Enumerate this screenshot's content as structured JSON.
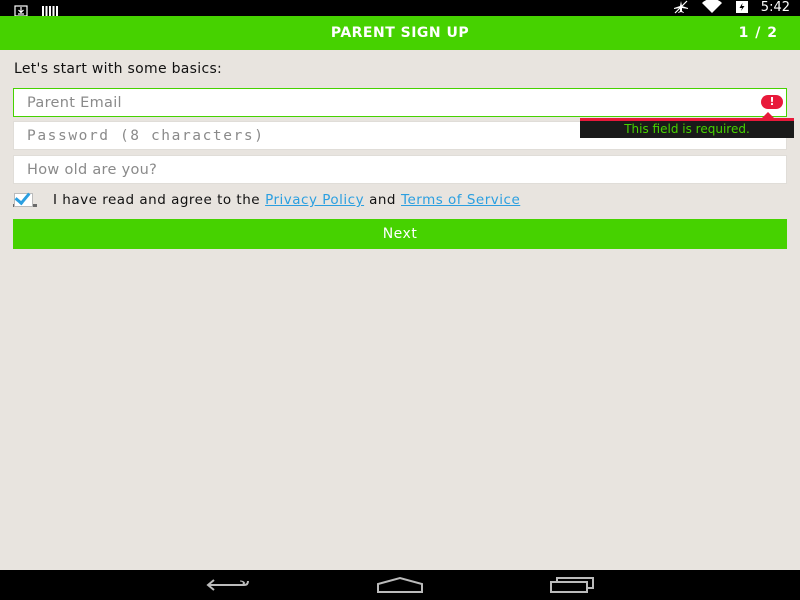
{
  "status_bar": {
    "left_icons": [
      "download-icon",
      "barcode-icon"
    ],
    "right_icons": [
      "airplane-mode-icon",
      "wifi-icon",
      "battery-icon"
    ],
    "time": "5:42"
  },
  "header": {
    "title": "PARENT SIGN UP",
    "step": "1 / 2"
  },
  "form": {
    "intro": "Let's start with some basics:",
    "email_placeholder": "Parent Email",
    "password_placeholder": "Password (8 characters)",
    "age_placeholder": "How old are you?",
    "email_error": "This field is required.",
    "agree": {
      "checked": true,
      "text_before": "I have read and agree to the",
      "privacy_link": "Privacy Policy",
      "joiner": "and",
      "terms_link": "Terms of Service"
    },
    "next_label": "Next"
  },
  "colors": {
    "accent": "#46d200",
    "error": "#e8193a",
    "link": "#2b9fe0",
    "background": "#e8e4df"
  },
  "nav_bar": {
    "icons": [
      "back-icon",
      "home-icon",
      "recent-apps-icon"
    ]
  }
}
